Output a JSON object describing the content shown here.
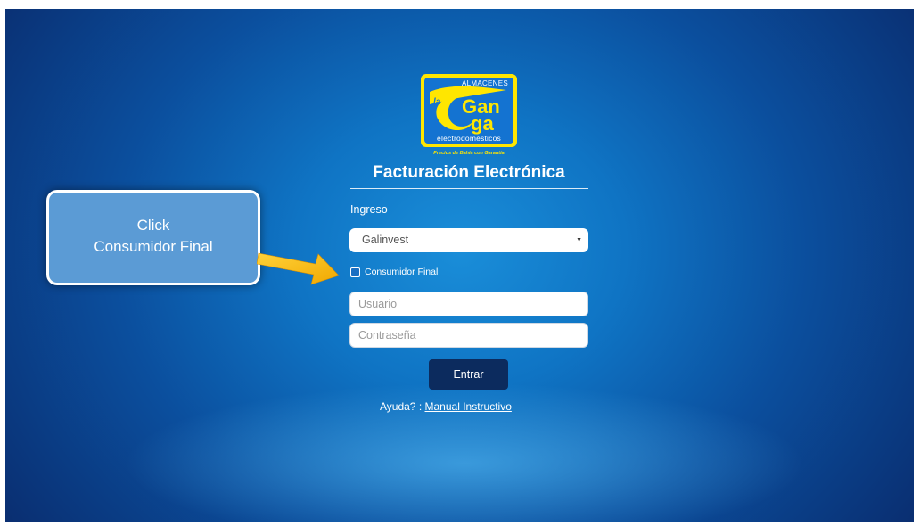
{
  "logo": {
    "top_text": "ALMACENES",
    "brand_small": "la",
    "brand_main_1": "Gan",
    "brand_main_2": "ga",
    "bottom_text": "electrodomésticos",
    "slogan": "Precios de Bahía con Garantía",
    "colors": {
      "frame": "#ffe600",
      "inner": "#1473d1"
    }
  },
  "page": {
    "title": "Facturación Electrónica"
  },
  "form": {
    "section_label": "Ingreso",
    "company_select": {
      "selected": "Galinvest"
    },
    "consumer_checkbox": {
      "label": "Consumidor Final",
      "checked": false
    },
    "username": {
      "placeholder": "Usuario",
      "value": ""
    },
    "password": {
      "placeholder": "Contraseña",
      "value": ""
    },
    "submit_label": "Entrar"
  },
  "help": {
    "prefix": "Ayuda? :",
    "link_label": "Manual Instructivo"
  },
  "annotation": {
    "line1": "Click",
    "line2": "Consumidor Final",
    "colors": {
      "callout": "#5b9bd5",
      "arrow": "#f5b800"
    }
  },
  "colors": {
    "background_center": "#1a8ed9",
    "background_edge": "#0a2f72",
    "button": "#0c2b5e"
  }
}
